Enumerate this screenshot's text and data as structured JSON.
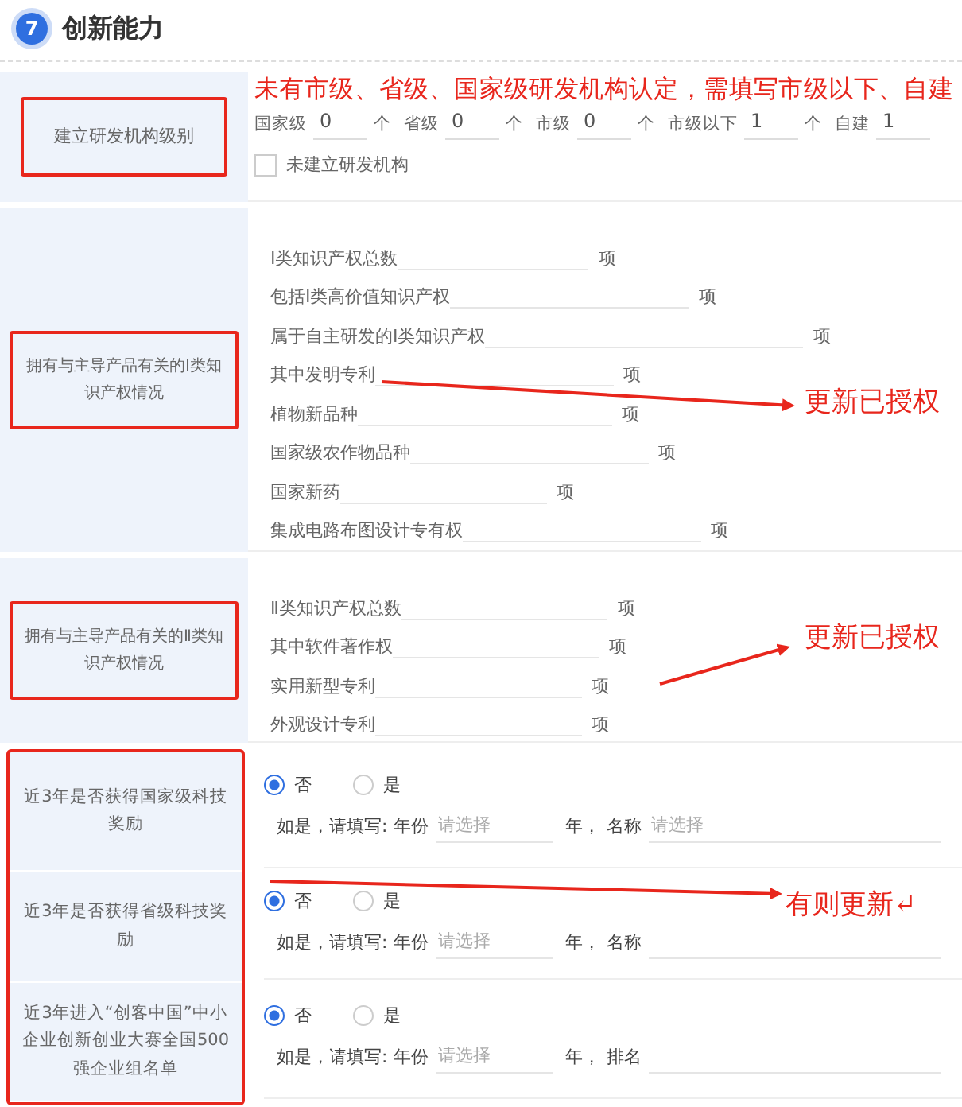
{
  "section": {
    "number": "7",
    "title": "创新能力"
  },
  "rd_institutions": {
    "label": "建立研发机构级别",
    "outlined": true,
    "note": "未有市级、省级、国家级研发机构认定，需填写市级以下、自建",
    "levels": [
      {
        "label": "国家级",
        "value": "0",
        "unit": "个"
      },
      {
        "label": "省级",
        "value": "0",
        "unit": "个"
      },
      {
        "label": "市级",
        "value": "0",
        "unit": "个"
      },
      {
        "label": "市级以下",
        "value": "1",
        "unit": "个"
      },
      {
        "label": "自建",
        "value": "1"
      }
    ],
    "checkbox": {
      "label": "未建立研发机构",
      "checked": false
    }
  },
  "ip_groups": [
    {
      "label": "拥有与主导产品有关的Ⅰ类知识产权情况",
      "outlined": true,
      "note": "更新已授权",
      "items": [
        {
          "label": "Ⅰ类知识产权总数",
          "unit": "项"
        },
        {
          "label": "包括Ⅰ类高价值知识产权",
          "unit": "项"
        },
        {
          "label": "属于自主研发的Ⅰ类知识产权",
          "unit": "项"
        },
        {
          "label": "其中发明专利",
          "unit": "项"
        },
        {
          "label": "植物新品种",
          "unit": "项"
        },
        {
          "label": "国家级农作物品种",
          "unit": "项"
        },
        {
          "label": "国家新药",
          "unit": "项"
        },
        {
          "label": "集成电路布图设计专有权",
          "unit": "项"
        }
      ]
    },
    {
      "label": "拥有与主导产品有关的Ⅱ类知识产权情况",
      "outlined": true,
      "note": "更新已授权",
      "items": [
        {
          "label": "Ⅱ类知识产权总数",
          "unit": "项"
        },
        {
          "label": "其中软件著作权",
          "unit": "项"
        },
        {
          "label": "实用新型专利",
          "unit": "项"
        },
        {
          "label": "外观设计专利",
          "unit": "项"
        }
      ]
    }
  ],
  "awards": {
    "outlined": true,
    "note": "有则更新↵",
    "rows": [
      {
        "label": "近3年是否获得国家级科技奖励",
        "options": [
          {
            "label": "否",
            "selected": true
          },
          {
            "label": "是",
            "selected": false
          }
        ],
        "prompt": "如是，请填写:",
        "year_label": "年份",
        "year_placeholder": "请选择",
        "year_unit": "年，",
        "name_label": "名称",
        "name_placeholder": "请选择"
      },
      {
        "label": "近3年是否获得省级科技奖励",
        "options": [
          {
            "label": "否",
            "selected": true
          },
          {
            "label": "是",
            "selected": false
          }
        ],
        "prompt": "如是，请填写:",
        "year_label": "年份",
        "year_placeholder": "请选择",
        "year_unit": "年，",
        "name_label": "名称"
      },
      {
        "label": "近3年进入“创客中国”中小企业创新创业大赛全国500强企业组名单",
        "options": [
          {
            "label": "否",
            "selected": true
          },
          {
            "label": "是",
            "selected": false
          }
        ],
        "prompt": "如是，请填写:",
        "year_label": "年份",
        "year_placeholder": "请选择",
        "year_unit": "年，",
        "name_label": "排名"
      }
    ]
  }
}
